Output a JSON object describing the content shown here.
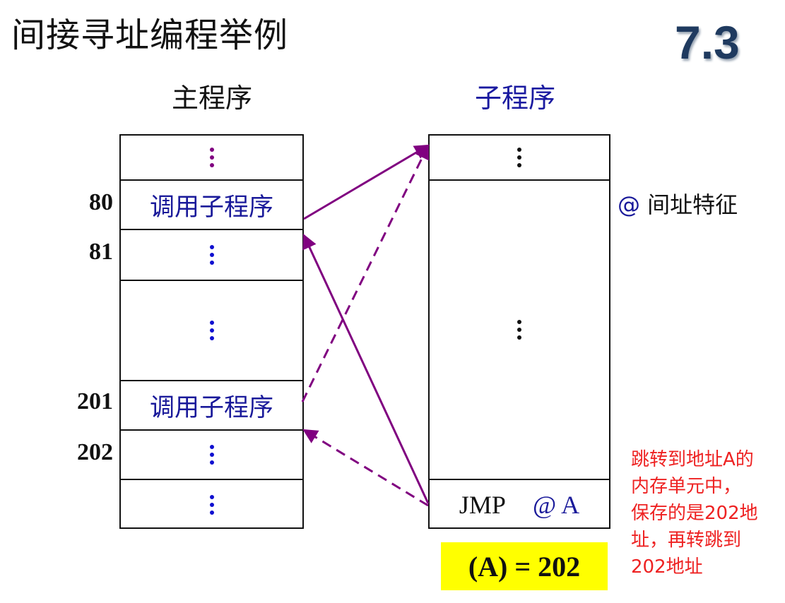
{
  "title": "间接寻址编程举例",
  "section_number": "7.3",
  "main_program": {
    "heading": "主程序",
    "call_label": "调用子程序",
    "addresses": {
      "a80": "80",
      "a81": "81",
      "a201": "201",
      "a202": "202"
    }
  },
  "subroutine": {
    "heading": "子程序",
    "jmp_mnemonic": "JMP",
    "jmp_operand": "@ A"
  },
  "indirect_feature": {
    "at_symbol": "@",
    "text": "间址特征"
  },
  "register_value": "(A) = 202",
  "note_lines": [
    "跳转到地址A的",
    "内存单元中，",
    "保存的是202地",
    "址，再转跳到",
    "202地址"
  ],
  "colors": {
    "arrow": "#800080",
    "blue_text": "#1a1a9a",
    "note_text": "#ee2222",
    "highlight": "#ffff00",
    "dot_blue": "#1010d0",
    "dot_purple": "#800080"
  }
}
